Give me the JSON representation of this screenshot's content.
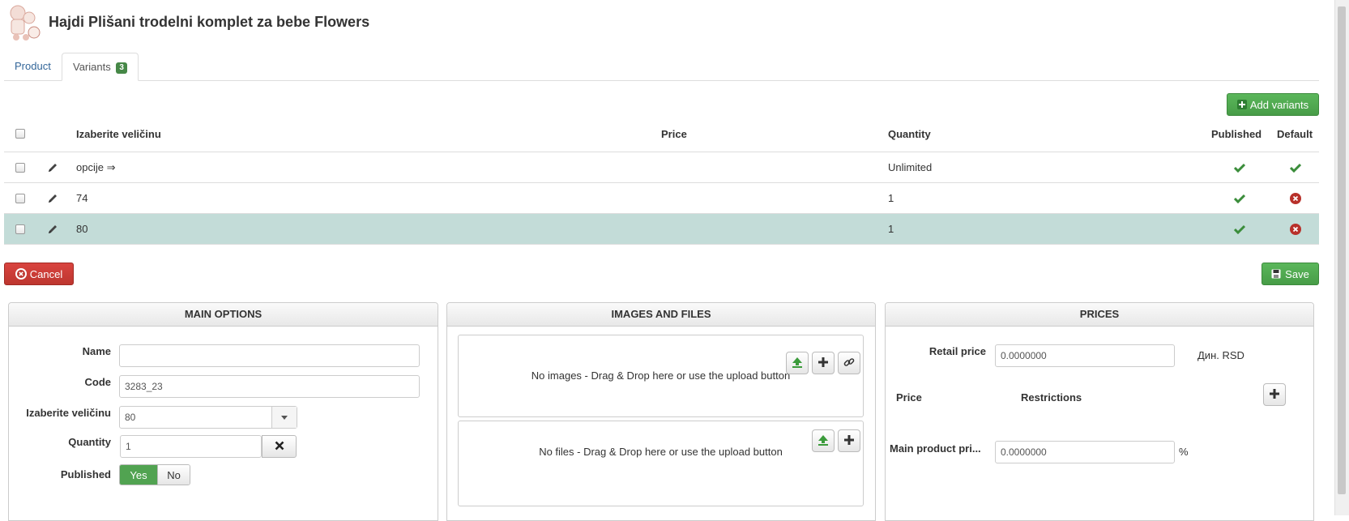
{
  "header": {
    "title": "Hajdi Plišani trodelni komplet za bebe Flowers"
  },
  "tabs": [
    {
      "label": "Product"
    },
    {
      "label": "Variants",
      "badge": "3"
    }
  ],
  "toolbar": {
    "add_variants_label": "Add variants",
    "cancel_label": "Cancel",
    "save_label": "Save"
  },
  "table": {
    "columns": {
      "size": "Izaberite veličinu",
      "price": "Price",
      "quantity": "Quantity",
      "published": "Published",
      "default": "Default"
    },
    "rows": [
      {
        "size": "opcije ⇒",
        "price": "",
        "quantity": "Unlimited",
        "published": true,
        "default": true,
        "highlighted": false
      },
      {
        "size": "74",
        "price": "",
        "quantity": "1",
        "published": true,
        "default": false,
        "highlighted": false
      },
      {
        "size": "80",
        "price": "",
        "quantity": "1",
        "published": true,
        "default": false,
        "highlighted": true
      }
    ]
  },
  "main_options": {
    "heading": "MAIN OPTIONS",
    "name_label": "Name",
    "name_value": "",
    "code_label": "Code",
    "code_value": "3283_23",
    "size_label": "Izaberite veličinu",
    "size_value": "80",
    "quantity_label": "Quantity",
    "quantity_value": "1",
    "published_label": "Published",
    "yes_label": "Yes",
    "no_label": "No"
  },
  "images_files": {
    "heading": "IMAGES AND FILES",
    "images_text": "No images - Drag & Drop here or use the upload button",
    "files_text": "No files - Drag & Drop here or use the upload button"
  },
  "prices": {
    "heading": "PRICES",
    "retail_label": "Retail price",
    "retail_value": "0.0000000",
    "currency": "Дин. RSD",
    "price_col": "Price",
    "restrictions_col": "Restrictions",
    "main_product_label": "Main product pri...",
    "main_product_value": "0.0000000",
    "percent": "%"
  },
  "colors": {
    "accent_green": "#5bb75b",
    "danger_red": "#bd362f",
    "highlight_row": "#c3dcd8",
    "link": "#336699"
  }
}
